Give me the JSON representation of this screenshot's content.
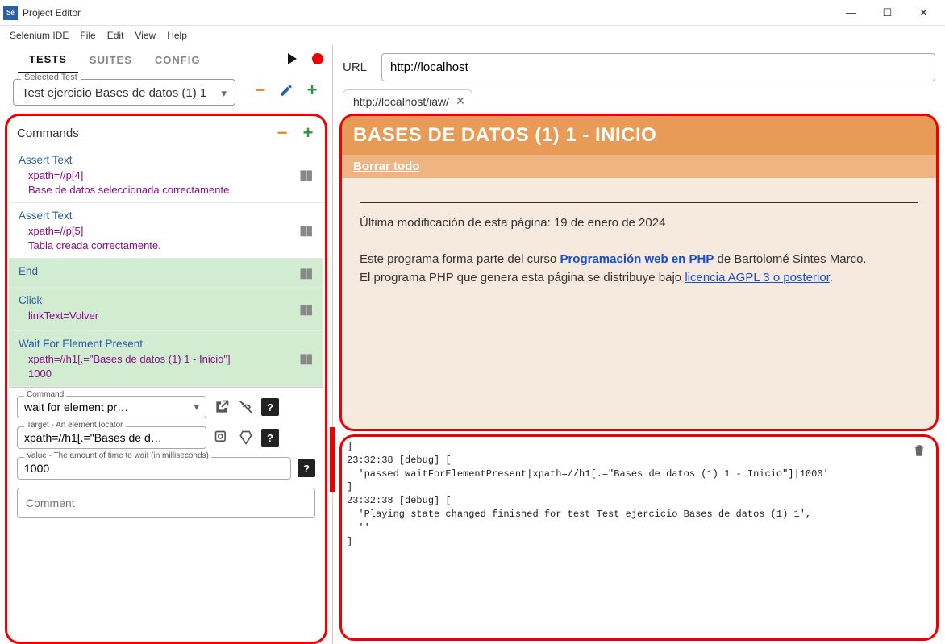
{
  "window": {
    "title": "Project Editor"
  },
  "menus": {
    "app": "Selenium IDE",
    "file": "File",
    "edit": "Edit",
    "view": "View",
    "help": "Help"
  },
  "tabs": {
    "tests": "TESTS",
    "suites": "SUITES",
    "config": "CONFIG"
  },
  "selectedTest": {
    "label": "Selected Test",
    "value": "Test ejercicio Bases de datos (1) 1"
  },
  "commandsHeader": "Commands",
  "commands": [
    {
      "name": "Assert Text",
      "target": "xpath=//p[4]",
      "value": "Base de datos seleccionada correctamente.",
      "green": false
    },
    {
      "name": "Assert Text",
      "target": "xpath=//p[5]",
      "value": "Tabla creada correctamente.",
      "green": false
    },
    {
      "name": "End",
      "target": "",
      "value": "",
      "green": true
    },
    {
      "name": "Click",
      "target": "linkText=Volver",
      "value": "",
      "green": true
    },
    {
      "name": "Wait For Element Present",
      "target": "xpath=//h1[.=\"Bases de datos (1) 1 - Inicio\"]",
      "value": "1000",
      "green": true
    }
  ],
  "form": {
    "commandLabel": "Command",
    "commandValue": "wait for element pr…",
    "targetLabel": "Target - An element locator",
    "targetValue": "xpath=//h1[.=\"Bases de d…",
    "valueLabel": "Value - The amount of time to wait (in milliseconds)",
    "valueValue": "1000",
    "commentPlaceholder": "Comment"
  },
  "url": {
    "label": "URL",
    "value": "http://localhost"
  },
  "browserTab": "http://localhost/iaw/",
  "preview": {
    "title": "BASES DE DATOS (1) 1 - INICIO",
    "sublink": "Borrar todo",
    "lastMod": "Última modificación de esta página: 19 de enero de 2024",
    "line2a": "Este programa forma parte del curso ",
    "line2link": "Programación web en PHP",
    "line2b": " de Bartolomé Sintes Marco.",
    "line3a": "El programa PHP que genera esta página se distribuye bajo ",
    "line3link": "licencia AGPL 3 o posterior",
    "line3b": "."
  },
  "log": {
    "l1": "]",
    "l2": "23:32:38 [debug] [",
    "l3": "  'passed waitForElementPresent|xpath=//h1[.=\"Bases de datos (1) 1 - Inicio\"]|1000'",
    "l4": "]",
    "l5": "23:32:38 [debug] [",
    "l6": "  'Playing state changed finished for test Test ejercicio Bases de datos (1) 1',",
    "l7": "  ''",
    "l8": "]"
  }
}
